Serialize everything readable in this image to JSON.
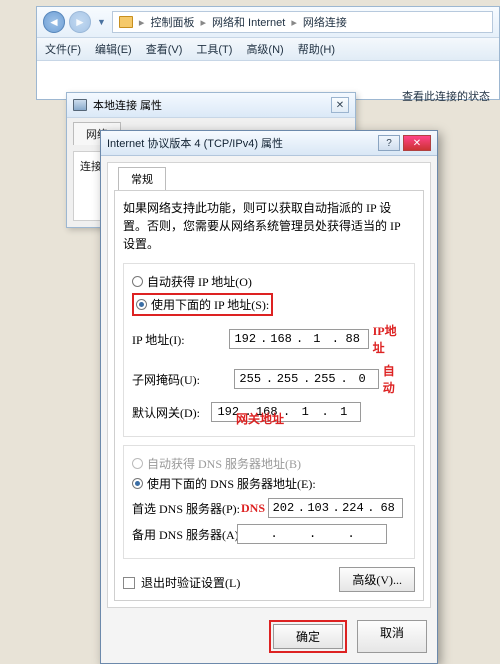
{
  "explorer": {
    "crumbs": [
      "控制面板",
      "网络和 Internet",
      "网络连接"
    ],
    "menu": [
      "文件(F)",
      "编辑(E)",
      "查看(V)",
      "工具(T)",
      "高级(N)",
      "帮助(H)"
    ],
    "right_note": "查看此连接的状态"
  },
  "nic_dialog": {
    "title": "本地连接 属性",
    "tab": "网络",
    "note": "连接时使用:"
  },
  "ipv4": {
    "title": "Internet 协议版本 4 (TCP/IPv4) 属性",
    "tab": "常规",
    "desc": "如果网络支持此功能，则可以获取自动指派的 IP 设置。否则，您需要从网络系统管理员处获得适当的 IP 设置。",
    "radio_auto_ip": "自动获得 IP 地址(O)",
    "radio_manual_ip": "使用下面的 IP 地址(S):",
    "lbl_ip": "IP 地址(I):",
    "lbl_mask": "子网掩码(U):",
    "lbl_gw": "默认网关(D):",
    "ip": {
      "a": "192",
      "b": "168",
      "c": "1",
      "d": "88"
    },
    "mask": {
      "a": "255",
      "b": "255",
      "c": "255",
      "d": "0"
    },
    "gw": {
      "a": "192",
      "b": "168",
      "c": "1",
      "d": "1"
    },
    "radio_auto_dns": "自动获得 DNS 服务器地址(B)",
    "radio_manual_dns": "使用下面的 DNS 服务器地址(E):",
    "lbl_dns1": "首选 DNS 服务器(P):",
    "lbl_dns2": "备用 DNS 服务器(A):",
    "dns1": {
      "a": "202",
      "b": "103",
      "c": "224",
      "d": "68"
    },
    "dns2": {
      "a": "",
      "b": "",
      "c": "",
      "d": ""
    },
    "chk_validate": "退出时验证设置(L)",
    "btn_advanced": "高级(V)...",
    "btn_ok": "确定",
    "btn_cancel": "取消"
  },
  "annot": {
    "ip": "IP地址",
    "auto": "自动",
    "gw": "网关地址",
    "dns": "DNS"
  }
}
